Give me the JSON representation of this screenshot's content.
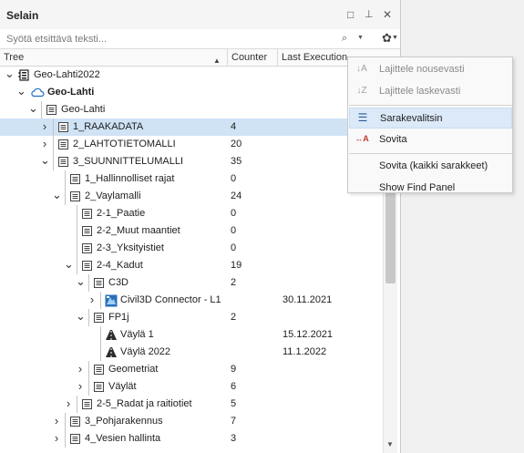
{
  "panel": {
    "title": "Selain",
    "restore_glyph": "□",
    "pin_glyph": "⊥",
    "close_glyph": "✕"
  },
  "search": {
    "placeholder": "Syötä etsittävä teksti...",
    "search_glyph": "⌕",
    "dropdown_glyph": "▼",
    "settings_glyph": "✿"
  },
  "columns": {
    "tree": "Tree",
    "counter": "Counter",
    "last_execution": "Last Execution",
    "sort_glyph": "▲"
  },
  "tree_rows": [
    {
      "level": 0,
      "expander": "open",
      "icon": "project-icon",
      "label": "Geo-Lahti2022",
      "bold": false,
      "count": "",
      "date": ""
    },
    {
      "level": 1,
      "expander": "open",
      "icon": "cloud-icon",
      "label": "Geo-Lahti",
      "bold": true,
      "count": "",
      "date": ""
    },
    {
      "level": 2,
      "expander": "open",
      "icon": "list-icon",
      "label": "Geo-Lahti",
      "bold": false,
      "count": "",
      "date": ""
    },
    {
      "level": 3,
      "expander": "closed",
      "icon": "list-icon",
      "label": "1_RAAKADATA",
      "bold": false,
      "count": "4",
      "date": "",
      "selected": true
    },
    {
      "level": 3,
      "expander": "closed",
      "icon": "list-icon",
      "label": "2_LAHTOTIETOMALLI",
      "bold": false,
      "count": "20",
      "date": ""
    },
    {
      "level": 3,
      "expander": "open",
      "icon": "list-icon",
      "label": "3_SUUNNITTELUMALLI",
      "bold": false,
      "count": "35",
      "date": ""
    },
    {
      "level": 4,
      "expander": "none",
      "icon": "list-icon",
      "label": "1_Hallinnolliset rajat",
      "bold": false,
      "count": "0",
      "date": ""
    },
    {
      "level": 4,
      "expander": "open",
      "icon": "list-icon",
      "label": "2_Vaylamalli",
      "bold": false,
      "count": "24",
      "date": ""
    },
    {
      "level": 5,
      "expander": "none",
      "icon": "list-icon",
      "label": "2-1_Paatie",
      "bold": false,
      "count": "0",
      "date": ""
    },
    {
      "level": 5,
      "expander": "none",
      "icon": "list-icon",
      "label": "2-2_Muut maantiet",
      "bold": false,
      "count": "0",
      "date": ""
    },
    {
      "level": 5,
      "expander": "none",
      "icon": "list-icon",
      "label": "2-3_Yksityistiet",
      "bold": false,
      "count": "0",
      "date": ""
    },
    {
      "level": 5,
      "expander": "open",
      "icon": "list-icon",
      "label": "2-4_Kadut",
      "bold": false,
      "count": "19",
      "date": ""
    },
    {
      "level": 6,
      "expander": "open",
      "icon": "list-icon",
      "label": "C3D",
      "bold": false,
      "count": "2",
      "date": ""
    },
    {
      "level": 7,
      "expander": "closed",
      "icon": "civil3d-icon",
      "label": "Civil3D Connector - L1",
      "bold": false,
      "count": "",
      "date": "30.11.2021"
    },
    {
      "level": 6,
      "expander": "open",
      "icon": "list-icon",
      "label": "FP1j",
      "bold": false,
      "count": "2",
      "date": ""
    },
    {
      "level": 7,
      "expander": "none",
      "icon": "road-icon",
      "label": "Väylä 1",
      "bold": false,
      "count": "",
      "date": "15.12.2021"
    },
    {
      "level": 7,
      "expander": "none",
      "icon": "road-icon",
      "label": "Väylä 2022",
      "bold": false,
      "count": "",
      "date": "11.1.2022"
    },
    {
      "level": 6,
      "expander": "closed",
      "icon": "list-icon",
      "label": "Geometriat",
      "bold": false,
      "count": "9",
      "date": ""
    },
    {
      "level": 6,
      "expander": "closed",
      "icon": "list-icon",
      "label": "Väylät",
      "bold": false,
      "count": "6",
      "date": ""
    },
    {
      "level": 5,
      "expander": "closed",
      "icon": "list-icon",
      "label": "2-5_Radat ja raitiotiet",
      "bold": false,
      "count": "5",
      "date": ""
    },
    {
      "level": 4,
      "expander": "closed",
      "icon": "list-icon",
      "label": "3_Pohjarakennus",
      "bold": false,
      "count": "7",
      "date": ""
    },
    {
      "level": 4,
      "expander": "closed",
      "icon": "list-icon",
      "label": "4_Vesien hallinta",
      "bold": false,
      "count": "3",
      "date": ""
    }
  ],
  "context_menu": {
    "items": [
      {
        "label": "Lajittele nousevasti",
        "icon": "sort-ascending-icon",
        "glyph": "↓A",
        "disabled": true
      },
      {
        "label": "Lajittele laskevasti",
        "icon": "sort-descending-icon",
        "glyph": "↓Z",
        "disabled": true
      },
      {
        "separator": true
      },
      {
        "label": "Sarakevalitsin",
        "icon": "column-chooser-icon",
        "glyph": "☰",
        "highlight": true
      },
      {
        "label": "Sovita",
        "icon": "best-fit-icon",
        "glyph": "↔A",
        "disabled": false
      },
      {
        "separator": true
      },
      {
        "label": "Sovita (kaikki sarakkeet)",
        "icon": "",
        "glyph": "",
        "disabled": false
      },
      {
        "label": "Show Find Panel",
        "icon": "",
        "glyph": "",
        "disabled": false
      }
    ]
  },
  "colors": {
    "selection": "#cfe3f5",
    "menu_highlight": "#dbe9f8",
    "accent_blue": "#1e6fc1",
    "icon_dark": "#222222"
  }
}
